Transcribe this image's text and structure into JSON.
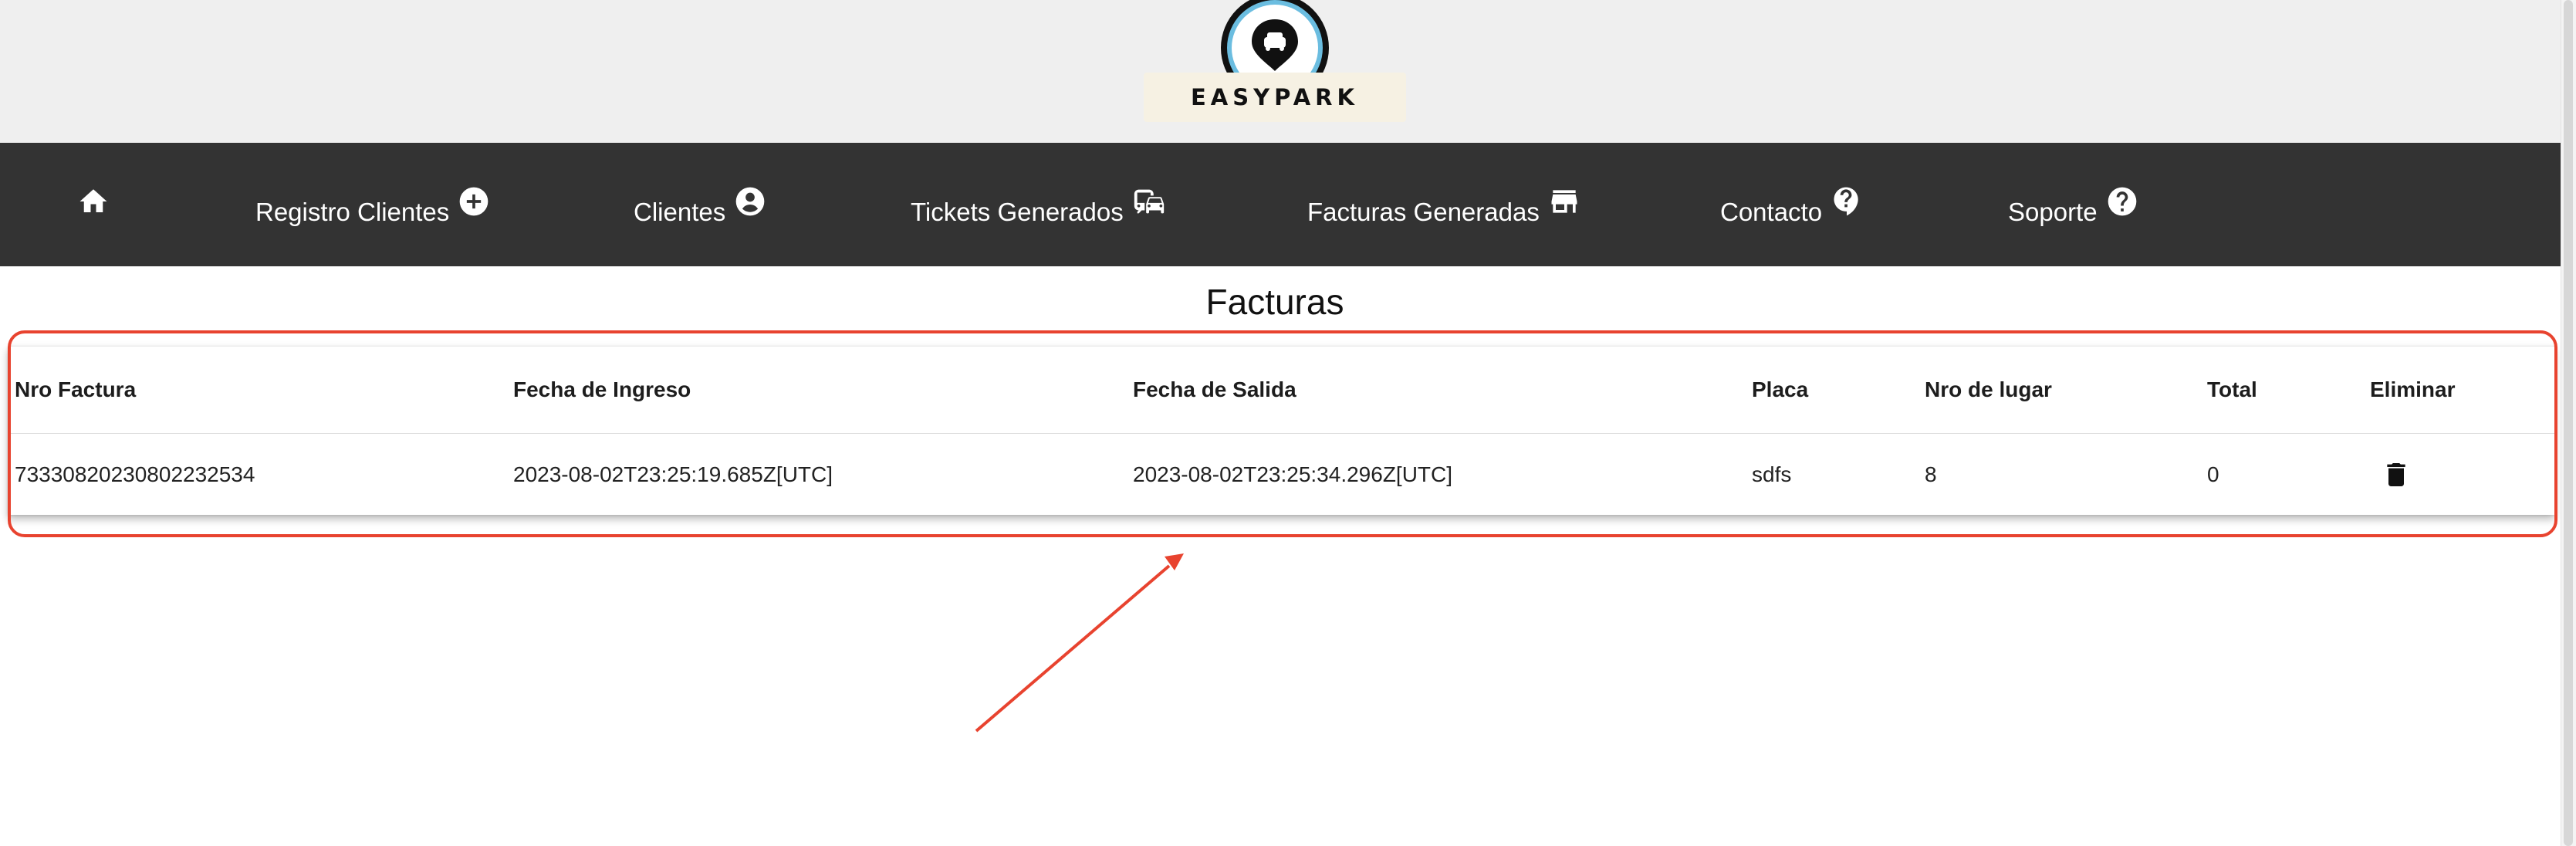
{
  "brand": {
    "name": "EASYPARK"
  },
  "nav": {
    "items": [
      {
        "label": "",
        "icon": "home-icon"
      },
      {
        "label": "Registro Clientes",
        "icon": "add-circle-icon"
      },
      {
        "label": "Clientes",
        "icon": "account-circle-icon"
      },
      {
        "label": "Tickets Generados",
        "icon": "commute-icon"
      },
      {
        "label": "Facturas Generadas",
        "icon": "store-icon"
      },
      {
        "label": "Contacto",
        "icon": "contact-support-icon"
      },
      {
        "label": "Soporte",
        "icon": "help-icon"
      }
    ]
  },
  "page": {
    "title": "Facturas"
  },
  "table": {
    "headers": [
      "Nro Factura",
      "Fecha de Ingreso",
      "Fecha de Salida",
      "Placa",
      "Nro de lugar",
      "Total",
      "Eliminar"
    ],
    "rows": [
      {
        "nro_factura": "73330820230802232534",
        "fecha_ingreso": "2023-08-02T23:25:19.685Z[UTC]",
        "fecha_salida": "2023-08-02T23:25:34.296Z[UTC]",
        "placa": "sdfs",
        "nro_lugar": "8",
        "total": "0",
        "delete_icon": "trash-icon"
      }
    ]
  },
  "annotation": {
    "color": "#e8432f"
  },
  "colors": {
    "navbar": "#333333",
    "header_bg": "#efefef",
    "logo_plate": "#f6f1e3",
    "logo_ring": "#6bbde0"
  }
}
